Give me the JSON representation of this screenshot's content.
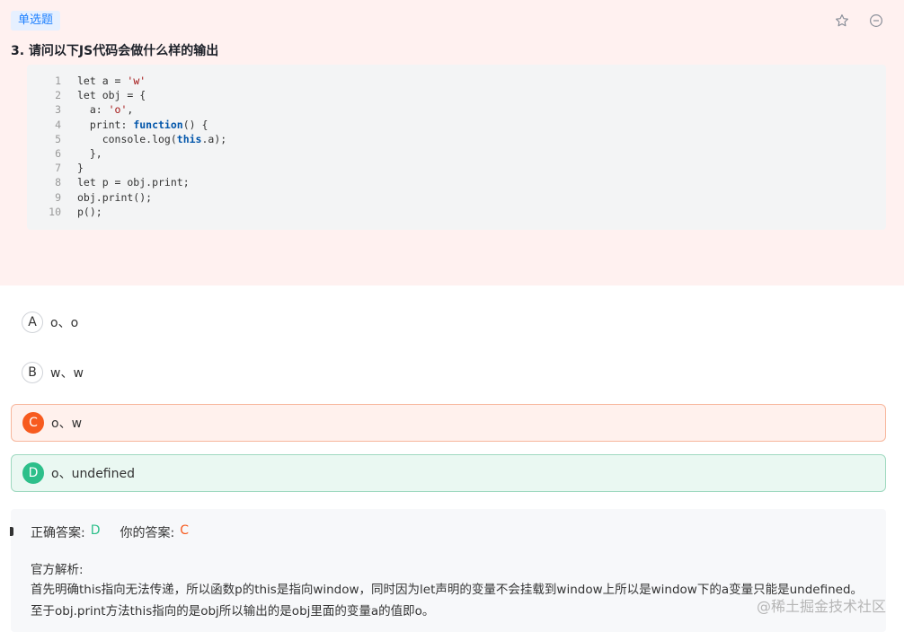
{
  "question": {
    "type_badge": "单选题",
    "title": "3. 请问以下JS代码会做什么样的输出",
    "icons": {
      "star": "star-icon",
      "collapse": "minus-circle-icon"
    },
    "code_lines": [
      {
        "n": "1",
        "text": "let a = 'w'"
      },
      {
        "n": "2",
        "text": "let obj = {"
      },
      {
        "n": "3",
        "text": "  a: 'o',"
      },
      {
        "n": "4",
        "text": "  print: function() {"
      },
      {
        "n": "5",
        "text": "    console.log(this.a);"
      },
      {
        "n": "6",
        "text": "  },"
      },
      {
        "n": "7",
        "text": "}"
      },
      {
        "n": "8",
        "text": "let p = obj.print;"
      },
      {
        "n": "9",
        "text": "obj.print();"
      },
      {
        "n": "10",
        "text": "p();"
      }
    ]
  },
  "options": [
    {
      "letter": "A",
      "text": "o、o",
      "state": "normal"
    },
    {
      "letter": "B",
      "text": "w、w",
      "state": "normal"
    },
    {
      "letter": "C",
      "text": "o、w",
      "state": "selected-wrong"
    },
    {
      "letter": "D",
      "text": "o、undefined",
      "state": "correct"
    }
  ],
  "answer": {
    "correct_label": "正确答案:",
    "correct_value": "D",
    "yours_label": "你的答案:",
    "yours_value": "C",
    "analysis_title": "官方解析:",
    "analysis_text": "首先明确this指向无法传递，所以函数p的this是指向window，同时因为let声明的变量不会挂载到window上所以是window下的a变量只能是undefined。至于obj.print方法this指向的是obj所以输出的是obj里面的变量a的值即o。"
  },
  "watermark": "@稀土掘金技术社区",
  "colors": {
    "question_bg": "#fff1f0",
    "badge_blue": "#1e80ff",
    "wrong_orange": "#f75b1f",
    "correct_green": "#2dbf8a"
  }
}
